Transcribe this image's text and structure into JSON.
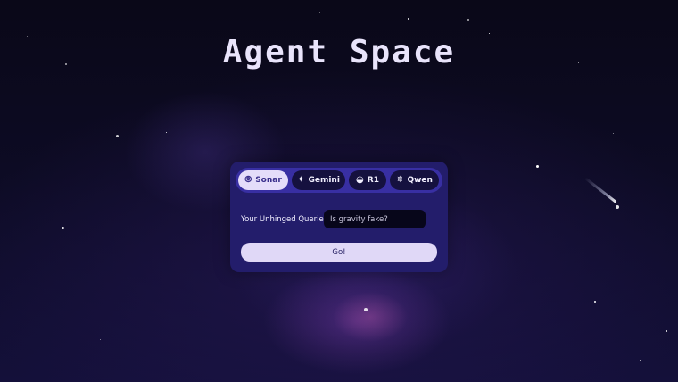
{
  "page": {
    "title": "Agent Space"
  },
  "tabs": [
    {
      "label": "Sonar",
      "icon": "sonar-icon",
      "glyph": "⦾",
      "active": true
    },
    {
      "label": "Gemini",
      "icon": "sparkle-icon",
      "glyph": "✦",
      "active": false
    },
    {
      "label": "R1",
      "icon": "whale-icon",
      "glyph": "◒",
      "active": false
    },
    {
      "label": "Qwen",
      "icon": "qwen-icon",
      "glyph": "✵",
      "active": false
    }
  ],
  "query": {
    "label": "Your Unhinged Queries:",
    "value": "Is gravity fake?"
  },
  "submit": {
    "label": "Go!"
  },
  "colors": {
    "panel": "#231d6b",
    "tab_bar": "#382fa3",
    "tab_active": "#e4dcfa",
    "button": "#e0d8f7"
  }
}
